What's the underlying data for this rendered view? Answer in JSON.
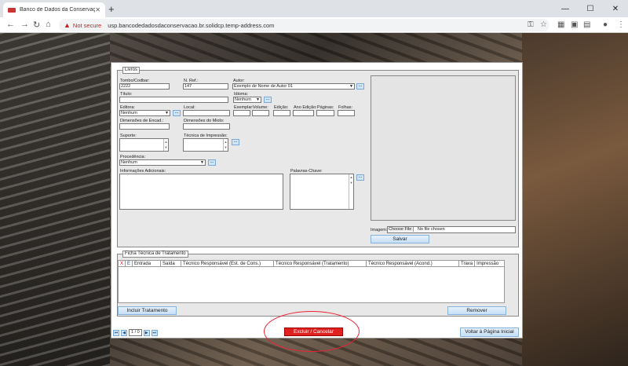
{
  "browser": {
    "tab_title": "Banco de Dados da Conservação",
    "new_tab": "+",
    "not_secure": "Not secure",
    "url": "usp.bancodedadosdaconservacao.br.solidcp.temp-address.com"
  },
  "livros": {
    "legend": "Livros",
    "tombo_label": "Tombo/Codbar:",
    "tombo_value": "2222",
    "nref_label": "N. Ref.:",
    "nref_value": "147",
    "autor_label": "Autor:",
    "autor_value": "Exemplo de Nome de Autor 01",
    "titulo_label": "Título:",
    "idioma_label": "Idioma:",
    "idioma_value": "Nenhum",
    "editora_label": "Editora:",
    "editora_value": "Nenhum",
    "local_label": "Local:",
    "exemplar_label": "Exemplar:",
    "volume_label": "Volume:",
    "edicao_label": "Edição:",
    "ano_label": "Ano Edição:",
    "paginas_label": "Páginas:",
    "folhas_label": "Folhas:",
    "dim_encad_label": "Dimensões de Encad.:",
    "dim_miolo_label": "Dimensões do Miolo:",
    "suporte_label": "Suporte:",
    "tecnica_label": "Técnica de Impressão:",
    "procedencia_label": "Procedência:",
    "procedencia_value": "Nenhum",
    "info_label": "Informações Adicionais:",
    "palavras_label": "Palavras-Chave:",
    "imagem_label": "Imagem:",
    "choose_file": "Choose File",
    "no_file": "No file chosen",
    "salvar": "Salvar",
    "dots": "..."
  },
  "ficha": {
    "legend": "Ficha Técnica de Tratamento",
    "headers": [
      "X",
      "E",
      "Entrada",
      "Saída",
      "Técnico Responsável (Est. de Cons.)",
      "Técnico Responsável (Tratamento)",
      "Técnico Responsável (Acond.)",
      "Trava",
      "Impressão"
    ],
    "incluir": "Incluir Tratamento",
    "remover": "Remover"
  },
  "footer": {
    "first": "⏮",
    "prev": "◀",
    "page": "1 / 0",
    "next": "▶",
    "last": "⏭",
    "excluir": "Excluir / Cancelar",
    "voltar": "Voltar à Página Inicial"
  }
}
